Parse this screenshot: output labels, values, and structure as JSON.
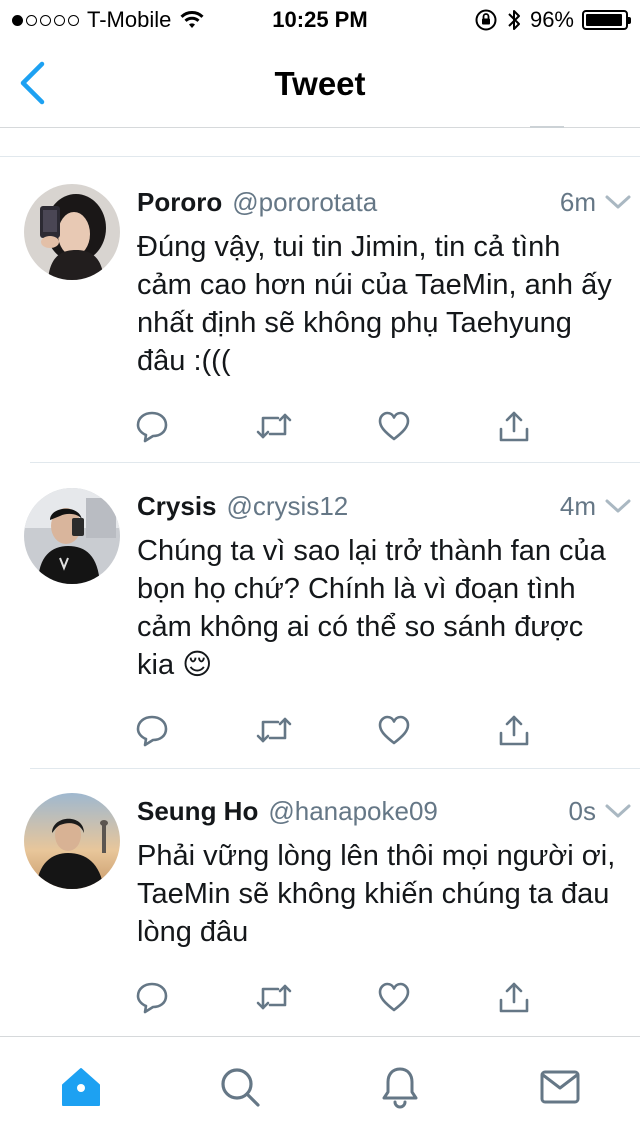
{
  "status_bar": {
    "carrier": "T-Mobile",
    "time": "10:25 PM",
    "battery": "96%",
    "signal_bars_filled": 1,
    "signal_bars_total": 5,
    "battery_level": 0.96
  },
  "nav": {
    "title": "Tweet",
    "back_icon": "chevron-left-icon"
  },
  "colors": {
    "accent": "#1da1f2",
    "secondary_text": "#657786",
    "icon_gray": "#657786"
  },
  "tweets": [
    {
      "name": "Pororo",
      "handle": "@pororotata",
      "time": "6m",
      "text": "Đúng vậy, tui tin Jimin, tin cả tình cảm cao hơn núi của TaeMin, anh ấy nhất định sẽ không phụ Taehyung đâu :((("
    },
    {
      "name": "Crysis",
      "handle": "@crysis12",
      "time": "4m",
      "text": "Chúng ta vì sao lại trở thành fan của bọn họ chứ? Chính là vì đoạn tình cảm không ai có thể so sánh được kia 😌"
    },
    {
      "name": "Seung Ho",
      "handle": "@hanapoke09",
      "time": "0s",
      "text": "Phải vững lòng lên thôi mọi người ơi, TaeMin sẽ không khiến chúng ta đau lòng đâu"
    }
  ],
  "tab_bar": {
    "tabs": [
      "home-icon",
      "search-icon",
      "notifications-icon",
      "messages-icon"
    ],
    "active": "home-icon"
  }
}
